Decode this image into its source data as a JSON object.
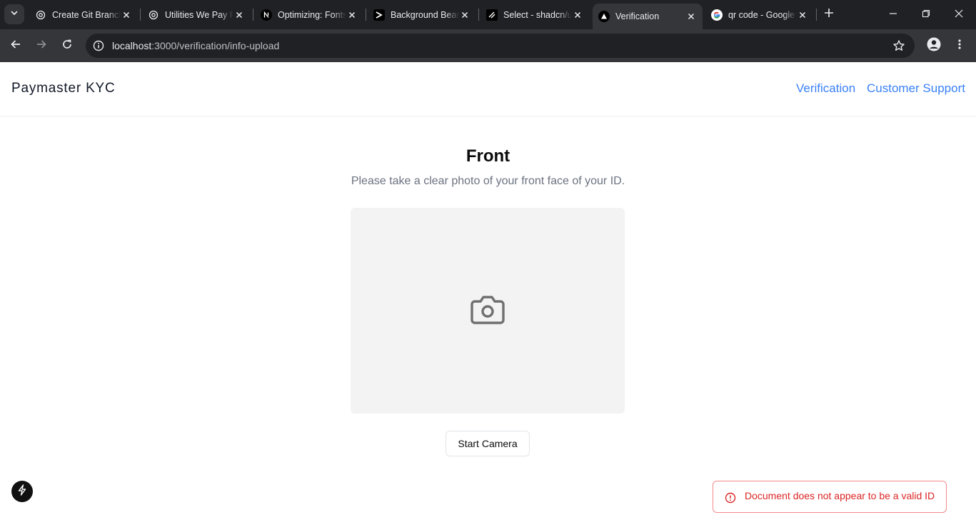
{
  "browser": {
    "tabs": [
      {
        "title": "Create Git Branch",
        "favicon": "openai-icon"
      },
      {
        "title": "Utilities We Pay For",
        "favicon": "openai-icon"
      },
      {
        "title": "Optimizing: Fonts",
        "favicon": "nextjs-icon"
      },
      {
        "title": "Background Beams",
        "favicon": "aceternity-icon"
      },
      {
        "title": "Select - shadcn/ui",
        "favicon": "shadcn-icon"
      },
      {
        "title": "Verification",
        "favicon": "vercel-triangle-icon",
        "active": true
      },
      {
        "title": "qr code - Google Search",
        "favicon": "google-icon"
      }
    ],
    "url_host": "localhost",
    "url_rest": ":3000/verification/info-upload"
  },
  "header": {
    "brand": "Paymaster KYC",
    "nav": [
      "Verification",
      "Customer Support"
    ],
    "link_color": "#3b82f6"
  },
  "main": {
    "title": "Front",
    "subtitle": "Please take a clear photo of your front face of your ID.",
    "placeholder_icon": "camera-icon",
    "start_camera_label": "Start Camera"
  },
  "toast": {
    "message": "Document does not appear to be a valid ID",
    "icon": "alert-circle-icon",
    "color": "#dc2626"
  }
}
